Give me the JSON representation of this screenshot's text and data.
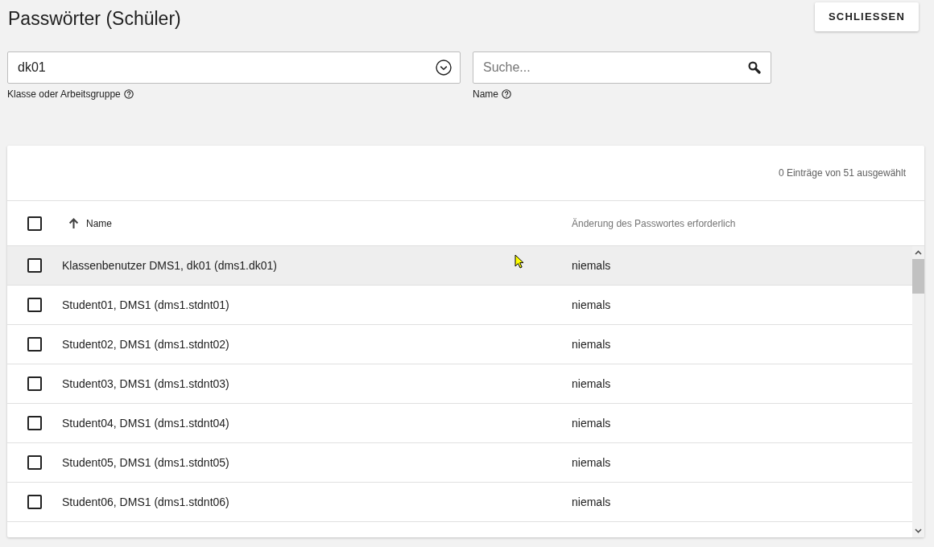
{
  "page": {
    "title": "Passwörter (Schüler)",
    "close_button": "SCHLIESSEN"
  },
  "filters": [
    {
      "kind": "select",
      "value": "dk01",
      "label": "Klasse oder Arbeitsgruppe"
    },
    {
      "kind": "search",
      "placeholder": "Suche...",
      "label": "Name"
    }
  ],
  "table": {
    "selection_summary": "0 Einträge von 51 ausgewählt",
    "select_all": {
      "checked": false
    },
    "columns": [
      {
        "label": "Name",
        "sorted": true
      },
      {
        "label": "Änderung des Passwortes erforderlich",
        "sorted": false
      }
    ],
    "rows": [
      {
        "checked": false,
        "hovered": true,
        "name": "Klassenbenutzer DMS1, dk01 (dms1.dk01)",
        "password_change": "niemals"
      },
      {
        "checked": false,
        "hovered": false,
        "name": "Student01, DMS1 (dms1.stdnt01)",
        "password_change": "niemals"
      },
      {
        "checked": false,
        "hovered": false,
        "name": "Student02, DMS1 (dms1.stdnt02)",
        "password_change": "niemals"
      },
      {
        "checked": false,
        "hovered": false,
        "name": "Student03, DMS1 (dms1.stdnt03)",
        "password_change": "niemals"
      },
      {
        "checked": false,
        "hovered": false,
        "name": "Student04, DMS1 (dms1.stdnt04)",
        "password_change": "niemals"
      },
      {
        "checked": false,
        "hovered": false,
        "name": "Student05, DMS1 (dms1.stdnt05)",
        "password_change": "niemals"
      },
      {
        "checked": false,
        "hovered": false,
        "name": "Student06, DMS1 (dms1.stdnt06)",
        "password_change": "niemals"
      }
    ]
  }
}
